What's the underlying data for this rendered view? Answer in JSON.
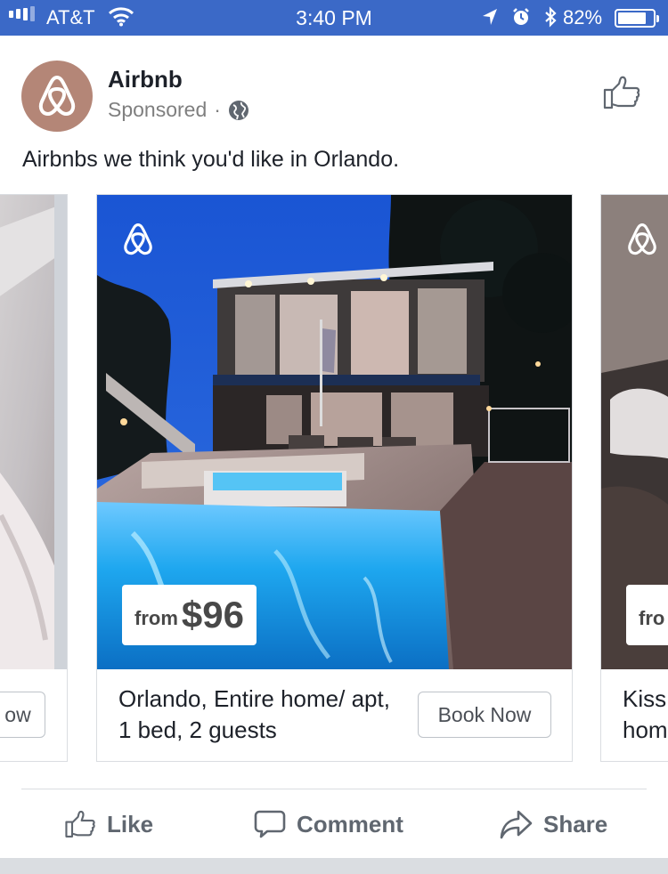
{
  "status_bar": {
    "carrier": "AT&T",
    "time": "3:40 PM",
    "battery_percent": "82%",
    "battery_level": 0.82,
    "signal_bars": 3,
    "icons": [
      "wifi-icon",
      "location-arrow-icon",
      "alarm-icon",
      "bluetooth-icon",
      "battery-icon"
    ]
  },
  "post": {
    "page_name": "Airbnb",
    "sponsored_label": "Sponsored",
    "separator": "·",
    "audience_icon": "globe-icon",
    "text": "Airbnbs we think you'd like in Orlando."
  },
  "carousel": {
    "left_card": {
      "button_partial": "ow"
    },
    "main_card": {
      "price_prefix": "from",
      "price": "$96",
      "title": "Orlando, Entire home/ apt, 1 bed, 2 guests",
      "button": "Book Now"
    },
    "right_card": {
      "price_prefix_partial": "fro",
      "title_partial": "Kiss hom"
    }
  },
  "actions": {
    "like": "Like",
    "comment": "Comment",
    "share": "Share"
  },
  "colors": {
    "status_bar": "#3b69c7",
    "avatar": "#b48677",
    "pool": "#24a9ee",
    "sky": "#1e5bd6"
  }
}
